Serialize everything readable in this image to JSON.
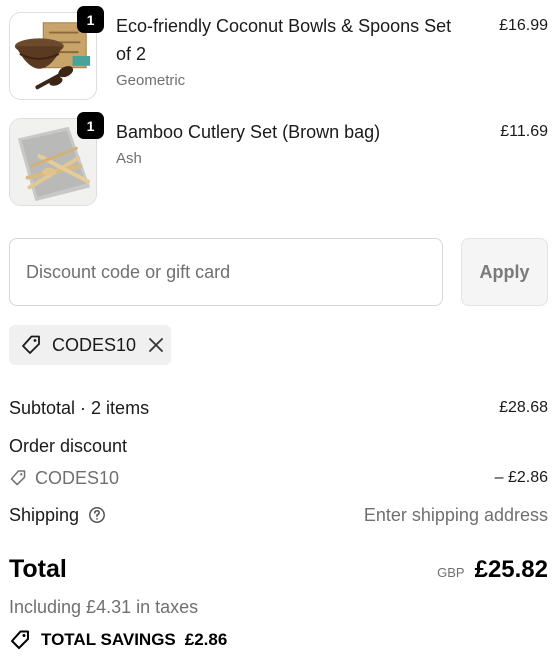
{
  "items": [
    {
      "title": "Eco-friendly Coconut Bowls & Spoons Set of 2",
      "variant": "Geometric",
      "price": "£16.99",
      "quantity": "1",
      "image_icon": "coconut-bowls-product-image"
    },
    {
      "title": "Bamboo Cutlery Set (Brown bag)",
      "variant": "Ash",
      "price": "£11.69",
      "quantity": "1",
      "image_icon": "bamboo-cutlery-product-image"
    }
  ],
  "discount": {
    "placeholder": "Discount code or gift card",
    "apply_label": "Apply",
    "applied_code": "CODES10"
  },
  "summary": {
    "subtotal_label": "Subtotal · 2 items",
    "subtotal_value": "£28.68",
    "order_discount_label": "Order discount",
    "discount_code": "CODES10",
    "discount_value": "– £2.86",
    "shipping_label": "Shipping",
    "shipping_value": "Enter shipping address"
  },
  "total": {
    "label": "Total",
    "currency": "GBP",
    "amount": "£25.82",
    "taxes": "Including £4.31 in taxes"
  },
  "savings": {
    "label": "TOTAL SAVINGS",
    "amount": "£2.86"
  }
}
